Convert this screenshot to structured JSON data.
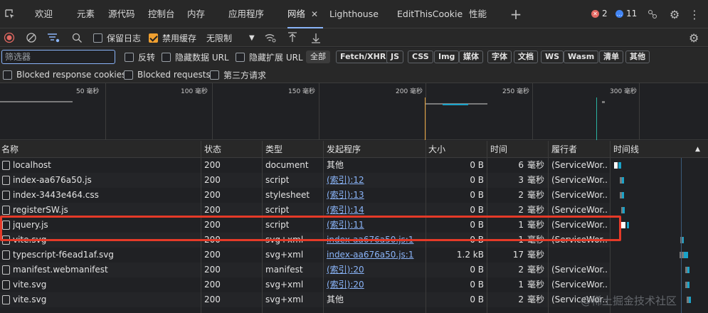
{
  "tabs": [
    "欢迎",
    "元素",
    "源代码",
    "控制台",
    "内存",
    "应用程序",
    "网络",
    "Lighthouse",
    "EditThisCookie",
    "性能"
  ],
  "active_tab_index": 6,
  "status": {
    "errors": "2",
    "messages": "11"
  },
  "toolbar": {
    "preserve_log": "保留日志",
    "disable_cache": "禁用缓存",
    "throttle": "无限制"
  },
  "filter": {
    "placeholder": "筛选器",
    "invert": "反转",
    "hide_data_url": "隐藏数据 URL",
    "hide_ext_url": "隐藏扩展 URL",
    "types": [
      "全部",
      "Fetch/XHR",
      "JS",
      "CSS",
      "Img",
      "媒体",
      "字体",
      "文档",
      "WS",
      "Wasm",
      "清单",
      "其他"
    ]
  },
  "options": {
    "blocked_cookies": "Blocked response cookies",
    "blocked_requests": "Blocked requests",
    "third_party": "第三方请求"
  },
  "overview_ticks": [
    "50 毫秒",
    "100 毫秒",
    "150 毫秒",
    "200 毫秒",
    "250 毫秒",
    "300 毫秒"
  ],
  "columns": [
    "名称",
    "状态",
    "类型",
    "发起程序",
    "大小",
    "时间",
    "履行者",
    "时间线"
  ],
  "rows": [
    {
      "name": "localhost",
      "status": "200",
      "type": "document",
      "initiator": "其他",
      "init_link": false,
      "size": "0 B",
      "time_num": "6",
      "time_unit": "毫秒",
      "fulfilled": "(ServiceWor..."
    },
    {
      "name": "index-aa676a50.js",
      "status": "200",
      "type": "script",
      "initiator": "(索引):12",
      "init_link": true,
      "size": "0 B",
      "time_num": "3",
      "time_unit": "毫秒",
      "fulfilled": "(ServiceWor..."
    },
    {
      "name": "index-3443e464.css",
      "status": "200",
      "type": "stylesheet",
      "initiator": "(索引):13",
      "init_link": true,
      "size": "0 B",
      "time_num": "2",
      "time_unit": "毫秒",
      "fulfilled": "(ServiceWor..."
    },
    {
      "name": "registerSW.js",
      "status": "200",
      "type": "script",
      "initiator": "(索引):14",
      "init_link": true,
      "size": "0 B",
      "time_num": "2",
      "time_unit": "毫秒",
      "fulfilled": "(ServiceWor..."
    },
    {
      "name": "jquery.js",
      "status": "200",
      "type": "script",
      "initiator": "(索引):11",
      "init_link": true,
      "size": "0 B",
      "time_num": "1",
      "time_unit": "毫秒",
      "fulfilled": "(ServiceWor..."
    },
    {
      "name": "vite.svg",
      "status": "200",
      "type": "svg+xml",
      "initiator": "index-aa676a50.js:1",
      "init_link": true,
      "size": "0 B",
      "time_num": "1",
      "time_unit": "毫秒",
      "fulfilled": "(ServiceWor..."
    },
    {
      "name": "typescript-f6ead1af.svg",
      "status": "200",
      "type": "svg+xml",
      "initiator": "index-aa676a50.js:1",
      "init_link": true,
      "size": "1.2 kB",
      "time_num": "17",
      "time_unit": "毫秒",
      "fulfilled": ""
    },
    {
      "name": "manifest.webmanifest",
      "status": "200",
      "type": "manifest",
      "initiator": "(索引):20",
      "init_link": true,
      "size": "0 B",
      "time_num": "2",
      "time_unit": "毫秒",
      "fulfilled": "(ServiceWor..."
    },
    {
      "name": "vite.svg",
      "status": "200",
      "type": "svg+xml",
      "initiator": "(索引):20",
      "init_link": true,
      "size": "0 B",
      "time_num": "1",
      "time_unit": "毫秒",
      "fulfilled": "(ServiceWor..."
    },
    {
      "name": "vite.svg",
      "status": "200",
      "type": "svg+xml",
      "initiator": "其他",
      "init_link": false,
      "size": "0 B",
      "time_num": "2",
      "time_unit": "毫秒",
      "fulfilled": "(ServiceWor..."
    }
  ],
  "highlighted_row": 4,
  "watermark": "@稀土掘金技术社区",
  "colors": {
    "accent": "#8ab4f8",
    "highlight_border": "#e53a28",
    "checkbox_on": "#f0a030",
    "error": "#e46962",
    "message": "#4285f4"
  }
}
